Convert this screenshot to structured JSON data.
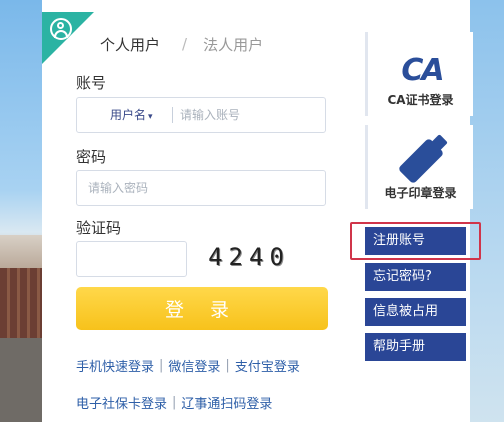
{
  "tabs": {
    "personal": "个人用户",
    "separator": "/",
    "legal": "法人用户"
  },
  "account": {
    "label": "账号",
    "type_select": "用户名",
    "caret": "▾",
    "placeholder": "请输入账号"
  },
  "password": {
    "label": "密码",
    "placeholder": "请输入密码"
  },
  "captcha": {
    "label": "验证码",
    "image_text": "4240"
  },
  "login_button": "登 录",
  "quick_links_row1": [
    "手机快速登录",
    "微信登录",
    "支付宝登录"
  ],
  "quick_links_row2": [
    "电子社保卡登录",
    "辽事通扫码登录"
  ],
  "link_separator": "|",
  "methods": {
    "ca_logo": "CA",
    "ca_label": "CA证书登录",
    "seal_label": "电子印章登录"
  },
  "side_buttons": {
    "register": "注册账号",
    "forgot": "忘记密码?",
    "occupied": "信息被占用",
    "help": "帮助手册"
  },
  "colors": {
    "accent_teal": "#2bb3a3",
    "brand_blue": "#2a4696",
    "login_yellow": "#f7c21b",
    "highlight_red": "#d0354a"
  }
}
